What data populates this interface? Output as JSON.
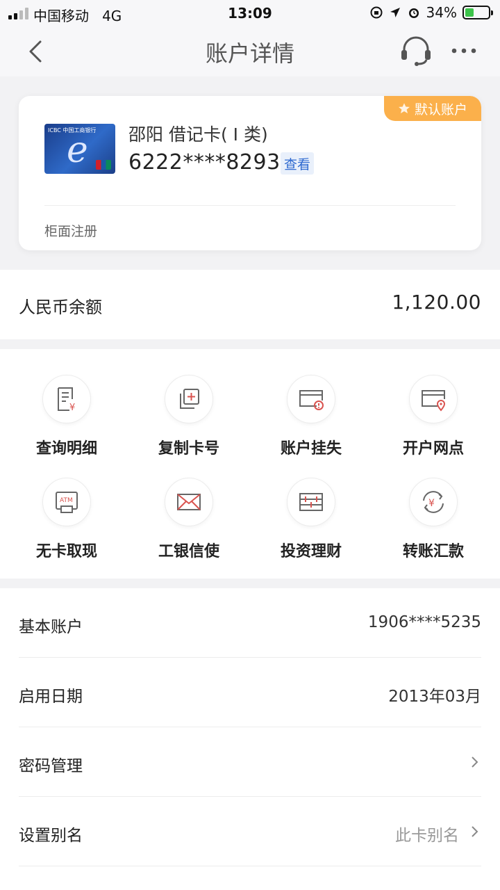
{
  "status_bar": {
    "carrier": "中国移动",
    "network": "4G",
    "time": "13:09",
    "battery": "34%"
  },
  "nav": {
    "title": "账户详情"
  },
  "card": {
    "badge": "默认账户",
    "name": "邵阳 借记卡( Ⅰ 类)",
    "number": "6222****8293",
    "view_label": "查看",
    "registration": "柜面注册",
    "card_brand": "ICBC 中国工商银行"
  },
  "balance": {
    "label": "人民币余额",
    "value": "1,120.00"
  },
  "functions": [
    {
      "label": "查询明细",
      "icon": "statement-icon"
    },
    {
      "label": "复制卡号",
      "icon": "copy-icon"
    },
    {
      "label": "账户挂失",
      "icon": "card-warning-icon"
    },
    {
      "label": "开户网点",
      "icon": "card-location-icon"
    },
    {
      "label": "无卡取现",
      "icon": "atm-icon"
    },
    {
      "label": "工银信使",
      "icon": "envelope-icon"
    },
    {
      "label": "投资理财",
      "icon": "abacus-icon"
    },
    {
      "label": "转账汇款",
      "icon": "transfer-icon"
    }
  ],
  "details": [
    {
      "label": "基本账户",
      "value": "1906****5235"
    },
    {
      "label": "启用日期",
      "value": "2013年03月"
    },
    {
      "label": "密码管理",
      "value": ""
    },
    {
      "label": "设置别名",
      "value": "此卡别名"
    }
  ],
  "colors": {
    "accent_red": "#d9534f",
    "badge_orange": "#fbb04b",
    "link_blue": "#2f6ad0",
    "battery_green": "#3cc34a"
  }
}
